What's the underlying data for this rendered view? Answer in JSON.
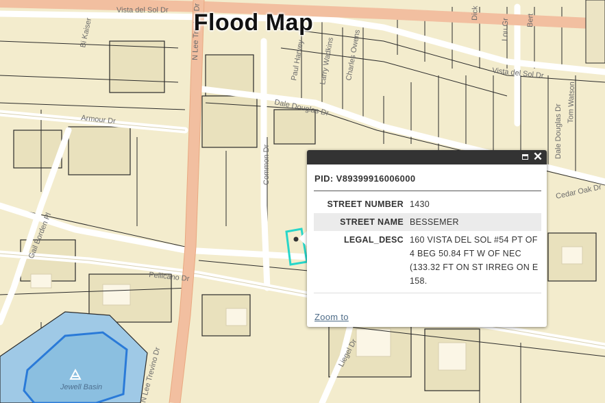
{
  "map": {
    "title": "Flood Map",
    "streets": {
      "vista_del_sol_top": "Vista del Sol Dr",
      "vista_del_sol_right": "Vista del Sol Dr",
      "dale_douglas": "Dale Douglas Dr",
      "dale_douglas_vertical": "Dale Douglas Dr",
      "armour": "Armour Dr",
      "common": "Common Dr",
      "gail_borden": "Gail Borden Pl",
      "pellicano": "Pellicano Dr",
      "lee_trevino": "N Lee Trevino Dr",
      "lee_trevino_top": "N Lee Trevino Dr",
      "paul_harvey": "Paul Harvey",
      "larry_wadkins": "Larry Wadkins",
      "charles_owens": "Charles Owens",
      "lou_graham": "Lou Gr",
      "dick_shaap": "Dick",
      "bert": "Bert",
      "cedar_oak": "Cedar Oak Dr",
      "liegel": "Liegel Dr",
      "tom_watson": "Tom Watson",
      "bi_kaiser": "Bi Kaiser",
      "basin_name": "Jewell Basin"
    },
    "colors": {
      "road_major": "#f2bfa0",
      "road_minor": "#ffffff",
      "land": "#f3eccd",
      "water": "#9fc9e6",
      "water_outline": "#2a7ad8",
      "selection": "#27d6c9"
    }
  },
  "popup": {
    "pid_label": "PID:",
    "pid_value": "V89399916006000",
    "fields": [
      {
        "label": "STREET NUMBER",
        "value": "1430"
      },
      {
        "label": "STREET NAME",
        "value": "BESSEMER"
      },
      {
        "label": "LEGAL_DESC",
        "value": "160 VISTA DEL SOL #54 PT OF 4 BEG 50.84 FT W OF NEC (133.32 FT ON ST IRREG ON E 158."
      }
    ],
    "zoom_label": "Zoom to",
    "maximize_icon": "maximize-icon",
    "close_icon": "close-icon"
  }
}
